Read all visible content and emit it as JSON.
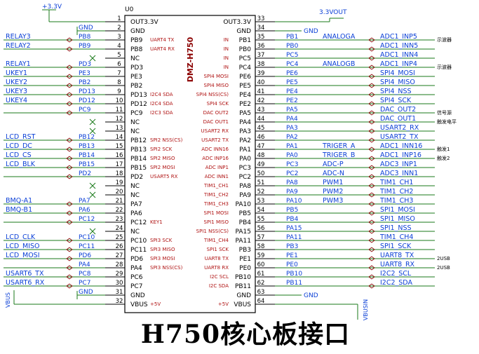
{
  "component": {
    "designator": "U0",
    "part_name": "DMZ-H750",
    "inner_left": [
      "OUT3.3V",
      "GND",
      "PB9",
      "PB8",
      "NC",
      "PD3",
      "PE3",
      "PB2",
      "PD13",
      "PD12",
      "PC9",
      "NC",
      "NC",
      "PB12",
      "PB13",
      "PB14",
      "PB15",
      "PD2",
      "NC",
      "NC",
      "PA7",
      "PA6",
      "PC12",
      "NC",
      "PC10",
      "PC11",
      "PD6",
      "PA4",
      "PC6",
      "PC7",
      "GND",
      "VBUS"
    ],
    "inner_left_func": [
      "",
      "",
      "UART4 TX",
      "UART4 RX",
      "",
      "",
      "",
      "",
      "I2C4 SDA",
      "I2C4 SDA",
      "I2C3 SDA",
      "",
      "",
      "SPI2 NSS(CS)",
      "SPI2 SCK",
      "SPI2 MISO",
      "SPI2 MOSI",
      "USART5 RX",
      "",
      "",
      "",
      "",
      "KEY1",
      "",
      "SPI3 SCK",
      "SPI3 MISO",
      "SPI3 MOSI",
      "SPI3 NSS(CS)",
      "",
      "",
      "",
      "+5V"
    ],
    "inner_right": [
      "OUT3.3V",
      "GND",
      "PB1",
      "PB0",
      "PC5",
      "PC4",
      "PE6",
      "PE5",
      "PE4",
      "PE2",
      "PA5",
      "PA4",
      "PA3",
      "PA2",
      "PA1",
      "PA0",
      "PC3",
      "PC2",
      "PA8",
      "PA9",
      "PA10",
      "PB5",
      "PB4",
      "PA15",
      "PA11",
      "PB3",
      "PE1",
      "PE0",
      "PB10",
      "PB11",
      "GND",
      "VBUS"
    ],
    "inner_right_func": [
      "",
      "",
      "IN",
      "IN",
      "IN",
      "IN",
      "SPI4 MOSI",
      "SPI4 MISO",
      "SPI4 NSS(CS)",
      "SPI4 SCK",
      "DAC OUT2",
      "DAC OUT1",
      "USART2 RX",
      "USART2 TX",
      "ADC INN16",
      "ADC INP16",
      "ADC INP1",
      "ADC INN1",
      "TIM1_CH1",
      "TIM1_CH2",
      "TIM1_CH3",
      "SPI1 MOSI",
      "SPI1 MISO",
      "SPI1 NSS(CS)",
      "TIM1_CH4",
      "SPI1 SCK",
      "UART8 TX",
      "UART8 RX",
      "I2C SCL",
      "I2C SDA",
      "",
      "+5V"
    ]
  },
  "left_pins": [
    {
      "num": "1",
      "port": "",
      "net": "+3.3V"
    },
    {
      "num": "2",
      "port": "GND",
      "net": ""
    },
    {
      "num": "3",
      "port": "PB8",
      "net": "RELAY3"
    },
    {
      "num": "4",
      "port": "PB9",
      "net": "RELAY2"
    },
    {
      "num": "5",
      "port": "",
      "net": ""
    },
    {
      "num": "6",
      "port": "PD3",
      "net": "RELAY1"
    },
    {
      "num": "7",
      "port": "PE3",
      "net": "UKEY1"
    },
    {
      "num": "8",
      "port": "PB2",
      "net": "UKEY2"
    },
    {
      "num": "9",
      "port": "PD13",
      "net": "UKEY3"
    },
    {
      "num": "10",
      "port": "PD12",
      "net": "UKEY4"
    },
    {
      "num": "11",
      "port": "PC9",
      "net": ""
    },
    {
      "num": "12",
      "port": "",
      "net": ""
    },
    {
      "num": "13",
      "port": "",
      "net": ""
    },
    {
      "num": "14",
      "port": "PB12",
      "net": "LCD_RST"
    },
    {
      "num": "15",
      "port": "PB13",
      "net": "LCD_DC"
    },
    {
      "num": "16",
      "port": "PB14",
      "net": "LCD_CS"
    },
    {
      "num": "17",
      "port": "PB15",
      "net": "LCD_BLK"
    },
    {
      "num": "18",
      "port": "PD2",
      "net": ""
    },
    {
      "num": "19",
      "port": "",
      "net": ""
    },
    {
      "num": "20",
      "port": "",
      "net": ""
    },
    {
      "num": "21",
      "port": "PA7",
      "net": "BMQ-A1"
    },
    {
      "num": "22",
      "port": "PA6",
      "net": "BMQ-B1"
    },
    {
      "num": "23",
      "port": "PC12",
      "net": ""
    },
    {
      "num": "24",
      "port": "",
      "net": ""
    },
    {
      "num": "25",
      "port": "PC10",
      "net": "LCD_CLK"
    },
    {
      "num": "26",
      "port": "PC11",
      "net": "LCD_MISO"
    },
    {
      "num": "27",
      "port": "PD6",
      "net": "LCD_MOSI"
    },
    {
      "num": "28",
      "port": "PA4",
      "net": ""
    },
    {
      "num": "29",
      "port": "PC8",
      "net": "USART6_TX"
    },
    {
      "num": "30",
      "port": "PC7",
      "net": "USART6_RX"
    },
    {
      "num": "31",
      "port": "GND",
      "net": ""
    },
    {
      "num": "32",
      "port": "",
      "net": "VBUS"
    }
  ],
  "right_pins": [
    {
      "num": "33",
      "port": "",
      "net": "3.3VOUT",
      "label": "",
      "note": ""
    },
    {
      "num": "34",
      "port": "GND",
      "net": "",
      "label": "",
      "note": ""
    },
    {
      "num": "35",
      "port": "PB1",
      "net": "ADC1_INP5",
      "label": "ANALOGA",
      "note": "示波器"
    },
    {
      "num": "36",
      "port": "PB0",
      "net": "ADC1_INN5",
      "label": "",
      "note": ""
    },
    {
      "num": "37",
      "port": "PC5",
      "net": "ADC1_INN4",
      "label": "",
      "note": ""
    },
    {
      "num": "38",
      "port": "PC4",
      "net": "ADC1_INP4",
      "label": "ANALOGB",
      "note": "示波器"
    },
    {
      "num": "39",
      "port": "PE6",
      "net": "SPI4_MOSI",
      "label": "",
      "note": ""
    },
    {
      "num": "40",
      "port": "PE5",
      "net": "SPI4_MISO",
      "label": "",
      "note": ""
    },
    {
      "num": "41",
      "port": "PE4",
      "net": "SPI4_NSS",
      "label": "",
      "note": ""
    },
    {
      "num": "42",
      "port": "PE2",
      "net": "SPI4_SCK",
      "label": "",
      "note": ""
    },
    {
      "num": "43",
      "port": "PA5",
      "net": "DAC_OUT2",
      "label": "",
      "note": "信号源"
    },
    {
      "num": "44",
      "port": "PA4",
      "net": "DAC_OUT1",
      "label": "",
      "note": "触发电平"
    },
    {
      "num": "45",
      "port": "PA3",
      "net": "USART2_RX",
      "label": "",
      "note": ""
    },
    {
      "num": "46",
      "port": "PA2",
      "net": "USART2_TX",
      "label": "",
      "note": ""
    },
    {
      "num": "47",
      "port": "PA1",
      "net": "ADC1_INN16",
      "label": "TRIGER_A",
      "note": "触发1"
    },
    {
      "num": "48",
      "port": "PA0",
      "net": "ADC1_INP16",
      "label": "TRIGER_B",
      "note": "触发2"
    },
    {
      "num": "49",
      "port": "PC3",
      "net": "ADC3_INP1",
      "label": "ADC-P",
      "note": ""
    },
    {
      "num": "50",
      "port": "PC2",
      "net": "ADC3_INN1",
      "label": "ADC-N",
      "note": ""
    },
    {
      "num": "51",
      "port": "PA8",
      "net": "TIM1_CH1",
      "label": "PWM1",
      "note": ""
    },
    {
      "num": "52",
      "port": "PA9",
      "net": "TIM1_CH2",
      "label": "PWM2",
      "note": ""
    },
    {
      "num": "53",
      "port": "PA10",
      "net": "TIM1_CH3",
      "label": "PWM3",
      "note": ""
    },
    {
      "num": "54",
      "port": "PB5",
      "net": "SPI1_MOSI",
      "label": "",
      "note": ""
    },
    {
      "num": "55",
      "port": "PB4",
      "net": "SPI1_MISO",
      "label": "",
      "note": ""
    },
    {
      "num": "56",
      "port": "PA15",
      "net": "SPI1_NSS",
      "label": "",
      "note": ""
    },
    {
      "num": "57",
      "port": "PA11",
      "net": "TIM1_CH4",
      "label": "",
      "note": ""
    },
    {
      "num": "58",
      "port": "PB3",
      "net": "SPI1_SCK",
      "label": "",
      "note": ""
    },
    {
      "num": "59",
      "port": "PE1",
      "net": "UART8_TX",
      "label": "",
      "note": "2USB"
    },
    {
      "num": "60",
      "port": "PE0",
      "net": "UART8_RX",
      "label": "",
      "note": "2USB"
    },
    {
      "num": "61",
      "port": "PB10",
      "net": "I2C2_SCL",
      "label": "",
      "note": ""
    },
    {
      "num": "62",
      "port": "PB11",
      "net": "I2C2_SDA",
      "label": "",
      "note": ""
    },
    {
      "num": "63",
      "port": "GND",
      "net": "",
      "label": "",
      "note": ""
    },
    {
      "num": "64",
      "port": "",
      "net": "VBUSIN",
      "label": "",
      "note": ""
    }
  ],
  "title": "H750核心板接口",
  "colors": {
    "wire": "#1a7a1a",
    "net": "#0a3fd6",
    "body": "#000000",
    "pin": "#8b0000",
    "func": "#b01414",
    "port": "#0a3fd6",
    "box_fill": "#ffffff"
  }
}
